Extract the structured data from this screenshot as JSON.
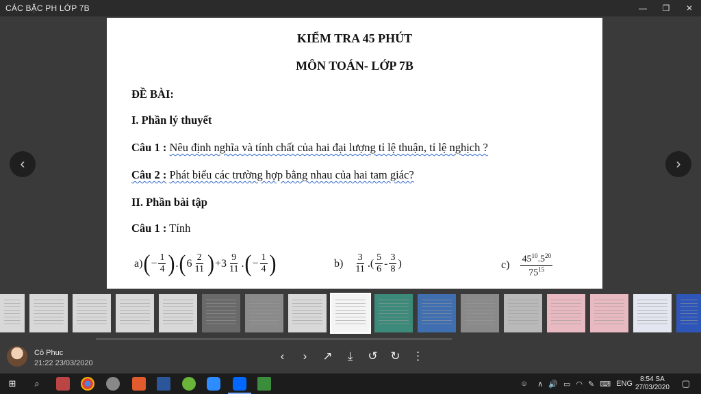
{
  "window": {
    "title": "CÁC BẶC PH LỚP 7B"
  },
  "document": {
    "title1": "KIỂM TRA 45 PHÚT",
    "title2": "MÔN TOÁN- LỚP 7B",
    "de_bai": "ĐỀ BÀI:",
    "section1": "I. Phần lý thuyết",
    "q1_label": "Câu 1 :",
    "q1_text": "Nêu định nghĩa và tính chất của hai đại lượng tỉ lệ thuận, tỉ lệ nghịch ?",
    "q2_label": "Câu 2 :",
    "q2_text": "Phát biểu các trường hợp bằng nhau của hai tam giác?",
    "section2": "II. Phần bài tập",
    "q3_label": "Câu 1 :",
    "q3_text": "Tính",
    "math": {
      "a_label": "a)",
      "b_label": "b)",
      "c_label": "c)"
    }
  },
  "thumbnails": {
    "count": 17,
    "selected_index": 8
  },
  "footer": {
    "user_name": "Cô Phuc",
    "timestamp": "21:22 23/03/2020"
  },
  "taskbar": {
    "language": "ENG",
    "time": "8:54 SA",
    "date": "27/03/2020"
  }
}
